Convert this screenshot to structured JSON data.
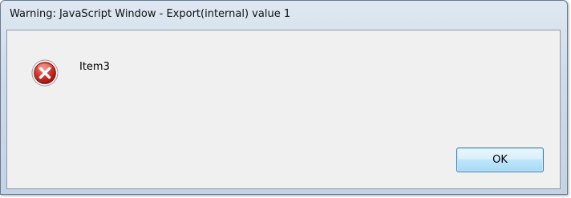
{
  "window": {
    "title": "Warning: JavaScript Window - Export(internal) value 1"
  },
  "dialog": {
    "icon": "error-icon",
    "message": "Item3",
    "ok_label": "OK"
  },
  "colors": {
    "icon_red": "#c0231f",
    "button_border": "#3c7fb1",
    "client_bg": "#f0f0f0"
  }
}
